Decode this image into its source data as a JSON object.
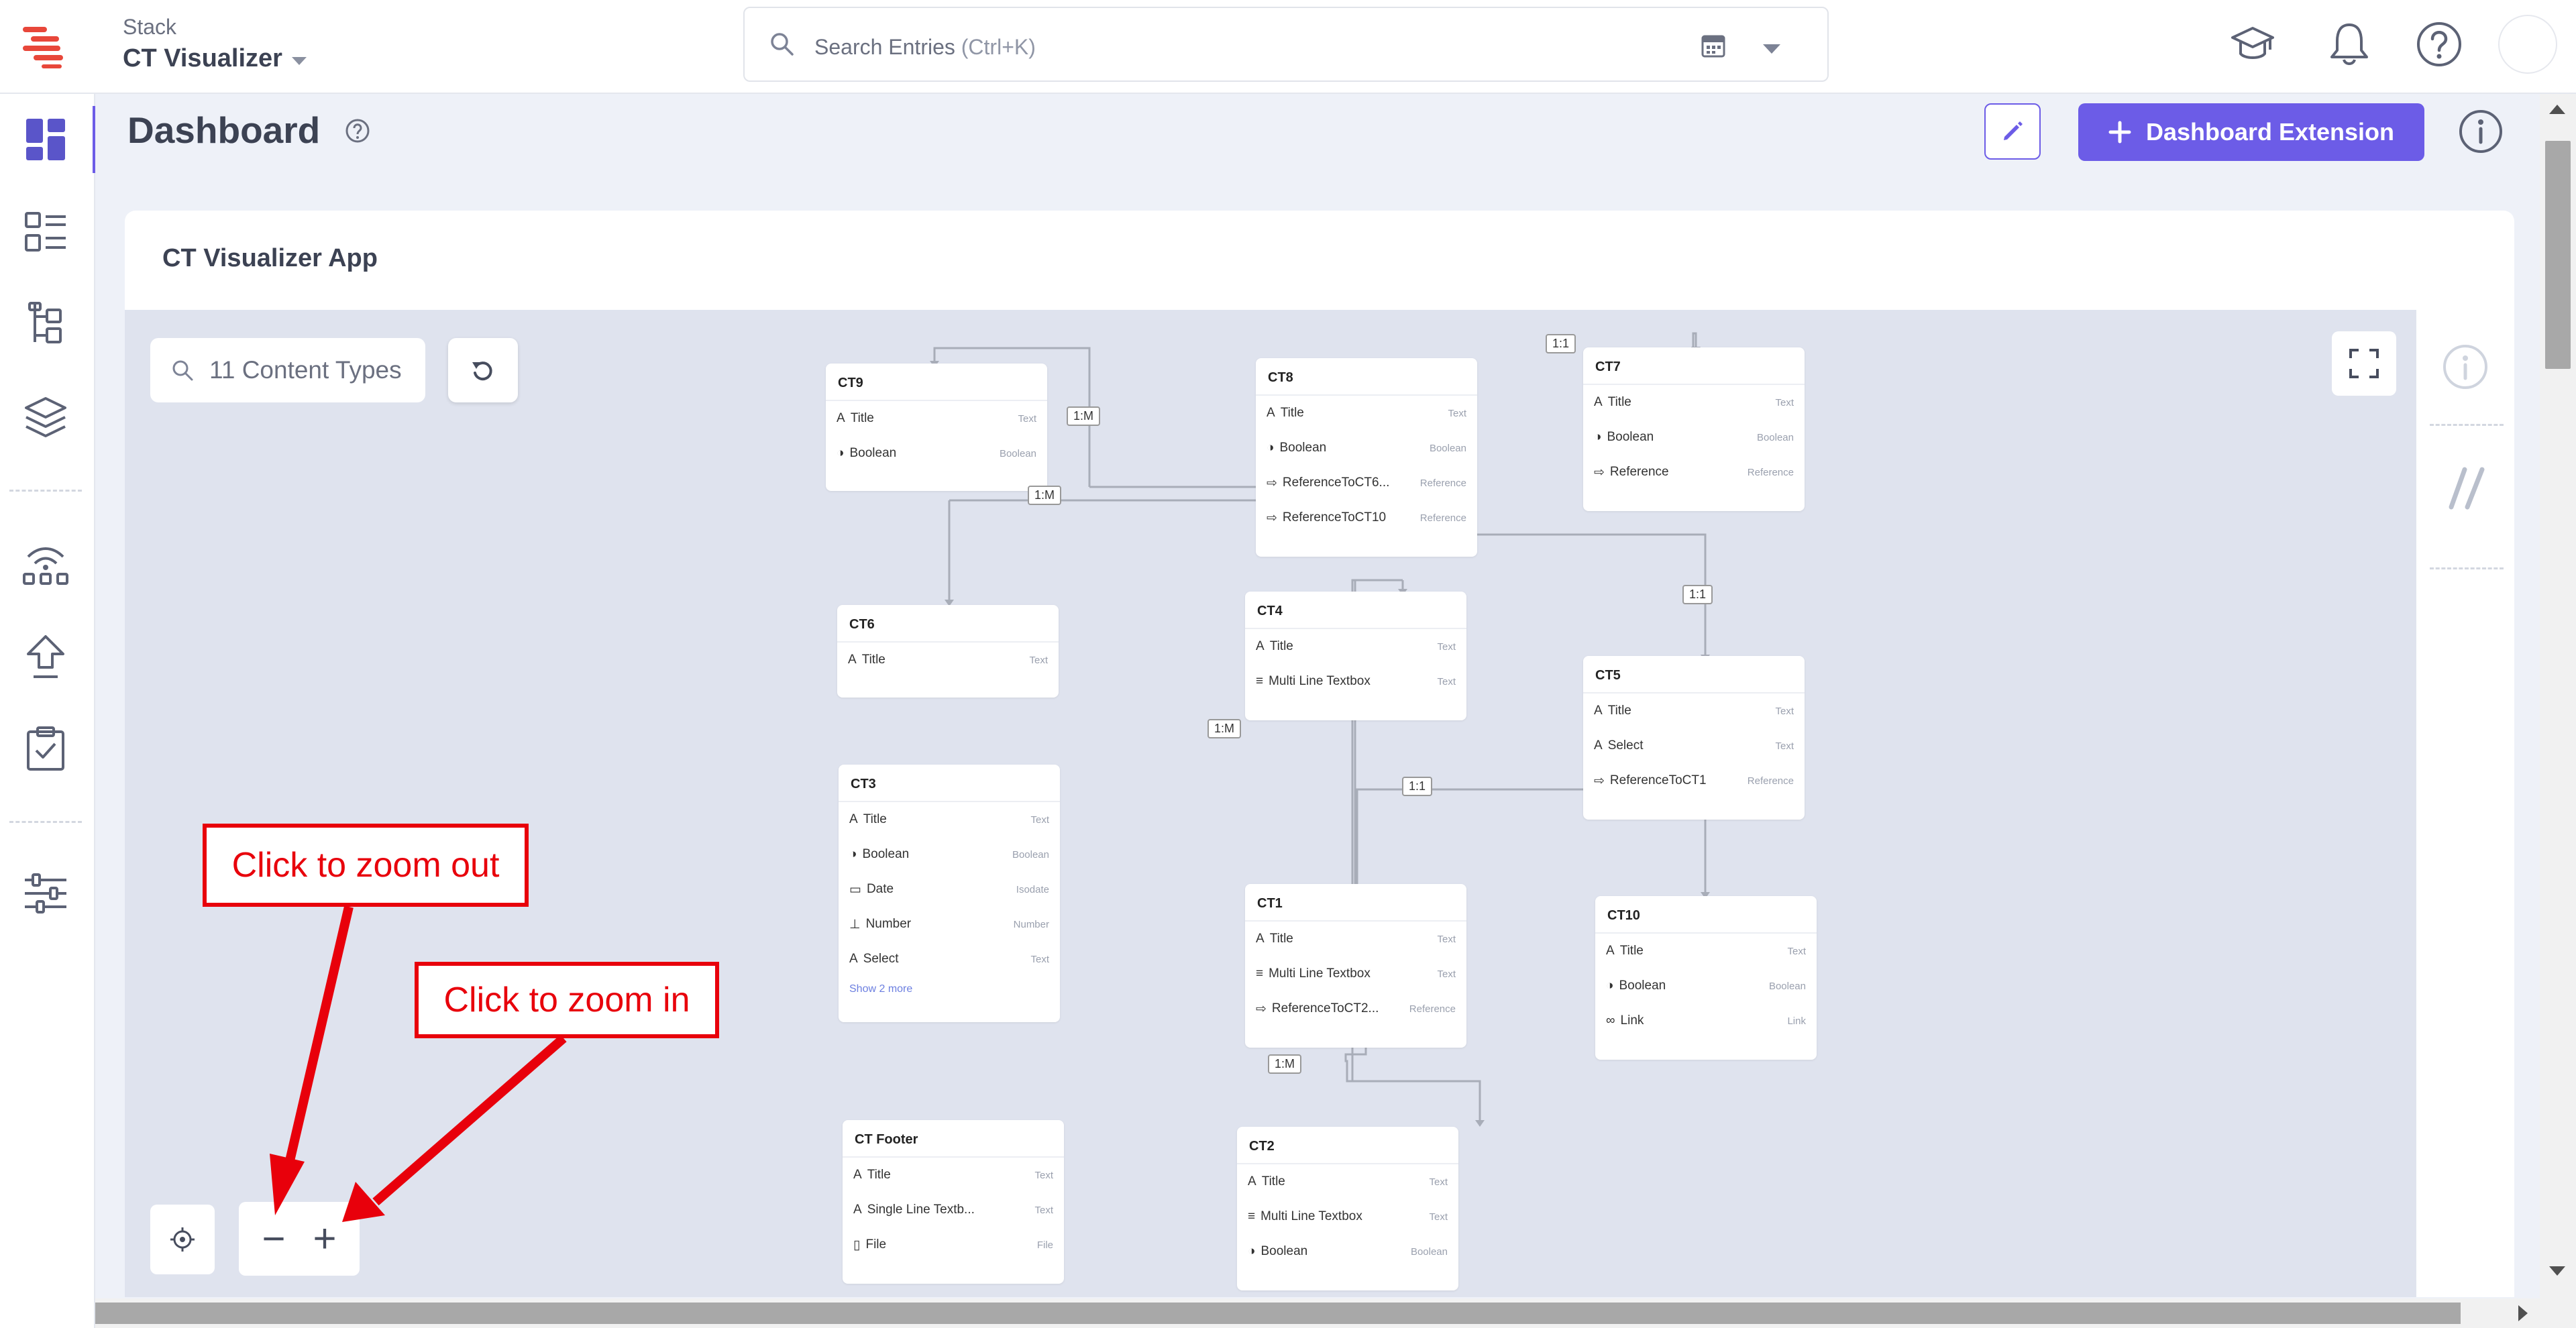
{
  "header": {
    "stack_label": "Stack",
    "stack_name": "CT Visualizer",
    "search_placeholder": "Search Entries",
    "search_shortcut": "(Ctrl+K)",
    "icons": [
      "academy-icon",
      "bell-icon",
      "help-icon",
      "avatar"
    ]
  },
  "nav": {
    "items": [
      "dashboard-icon",
      "entries-icon",
      "content-models-icon",
      "assets-icon",
      "releases-icon",
      "deploy-icon",
      "tasks-icon",
      "settings-icon"
    ]
  },
  "page": {
    "title": "Dashboard",
    "dashboard_extension_label": "Dashboard Extension"
  },
  "card": {
    "title": "CT Visualizer App",
    "search_label": "11 Content Types"
  },
  "nodes": [
    {
      "name": "CT9",
      "fields": [
        {
          "label": "Title",
          "type": "Text",
          "icon": "A"
        },
        {
          "label": "Boolean",
          "type": "Boolean",
          "icon": "◑"
        }
      ]
    },
    {
      "name": "CT8",
      "fields": [
        {
          "label": "Title",
          "type": "Text",
          "icon": "A"
        },
        {
          "label": "Boolean",
          "type": "Boolean",
          "icon": "◑"
        },
        {
          "label": "ReferenceToCT6...",
          "type": "Reference",
          "icon": "⇨"
        },
        {
          "label": "ReferenceToCT10",
          "type": "Reference",
          "icon": "⇨"
        }
      ]
    },
    {
      "name": "CT7",
      "fields": [
        {
          "label": "Title",
          "type": "Text",
          "icon": "A"
        },
        {
          "label": "Boolean",
          "type": "Boolean",
          "icon": "◑"
        },
        {
          "label": "Reference",
          "type": "Reference",
          "icon": "⇨"
        }
      ]
    },
    {
      "name": "CT6",
      "fields": [
        {
          "label": "Title",
          "type": "Text",
          "icon": "A"
        }
      ]
    },
    {
      "name": "CT4",
      "fields": [
        {
          "label": "Title",
          "type": "Text",
          "icon": "A"
        },
        {
          "label": "Multi Line Textbox",
          "type": "Text",
          "icon": "≡"
        }
      ]
    },
    {
      "name": "CT5",
      "fields": [
        {
          "label": "Title",
          "type": "Text",
          "icon": "A"
        },
        {
          "label": "Select",
          "type": "Text",
          "icon": "A"
        },
        {
          "label": "ReferenceToCT1",
          "type": "Reference",
          "icon": "⇨"
        }
      ]
    },
    {
      "name": "CT3",
      "fields": [
        {
          "label": "Title",
          "type": "Text",
          "icon": "A"
        },
        {
          "label": "Boolean",
          "type": "Boolean",
          "icon": "◑"
        },
        {
          "label": "Date",
          "type": "Isodate",
          "icon": "▭"
        },
        {
          "label": "Number",
          "type": "Number",
          "icon": "⊥"
        },
        {
          "label": "Select",
          "type": "Text",
          "icon": "A"
        }
      ],
      "more": "Show 2 more"
    },
    {
      "name": "CT1",
      "fields": [
        {
          "label": "Title",
          "type": "Text",
          "icon": "A"
        },
        {
          "label": "Multi Line Textbox",
          "type": "Text",
          "icon": "≡"
        },
        {
          "label": "ReferenceToCT2...",
          "type": "Reference",
          "icon": "⇨"
        }
      ]
    },
    {
      "name": "CT10",
      "fields": [
        {
          "label": "Title",
          "type": "Text",
          "icon": "A"
        },
        {
          "label": "Boolean",
          "type": "Boolean",
          "icon": "◑"
        },
        {
          "label": "Link",
          "type": "Link",
          "icon": "∞"
        }
      ]
    },
    {
      "name": "CT Footer",
      "fields": [
        {
          "label": "Title",
          "type": "Text",
          "icon": "A"
        },
        {
          "label": "Single Line Textb...",
          "type": "Text",
          "icon": "A"
        },
        {
          "label": "File",
          "type": "File",
          "icon": "▯"
        }
      ]
    },
    {
      "name": "CT2",
      "fields": [
        {
          "label": "Title",
          "type": "Text",
          "icon": "A"
        },
        {
          "label": "Multi Line Textbox",
          "type": "Text",
          "icon": "≡"
        },
        {
          "label": "Boolean",
          "type": "Boolean",
          "icon": "◑"
        }
      ]
    }
  ],
  "relations": [
    "1:M",
    "1:M",
    "1:1",
    "1:1",
    "1:M",
    "1:1",
    "1:M"
  ],
  "annotations": {
    "zoom_out": "Click to zoom out",
    "zoom_in": "Click to zoom in"
  },
  "zoom": {
    "minus": "−",
    "plus": "+"
  },
  "colors": {
    "accent": "#6c5ce7",
    "annotation": "#e8000b",
    "canvas": "#dfe3ee",
    "logo": "#e8473a"
  }
}
